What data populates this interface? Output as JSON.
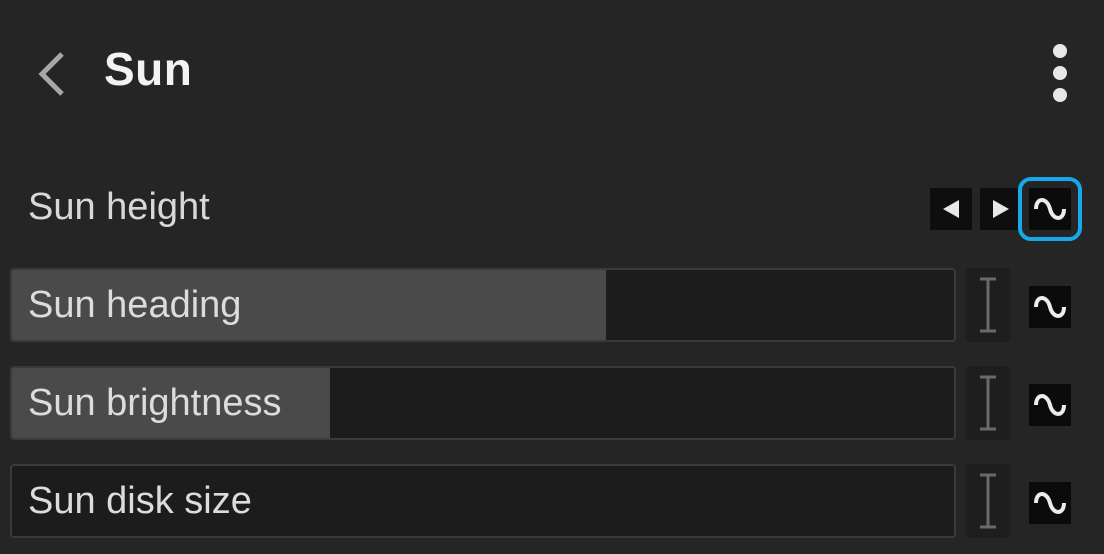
{
  "header": {
    "back_icon": "chevron-left-icon",
    "title": "Sun",
    "more_icon": "more-vertical-icon"
  },
  "properties": [
    {
      "label": "Sun height"
    },
    {
      "label": "Sun heading",
      "fill_fraction": 0.628
    },
    {
      "label": "Sun brightness",
      "fill_fraction": 0.336
    },
    {
      "label": "Sun disk size",
      "fill_fraction": 0.0
    }
  ],
  "icons": {
    "previous": "triangle-left-icon",
    "next": "triangle-right-icon",
    "animate": "wave-icon",
    "text_cursor": "text-cursor-icon"
  },
  "colors": {
    "background": "#252526",
    "slider_fill": "#4a4a4a",
    "slider_track": "#1c1c1c",
    "selection_outline": "#16a8e8"
  }
}
